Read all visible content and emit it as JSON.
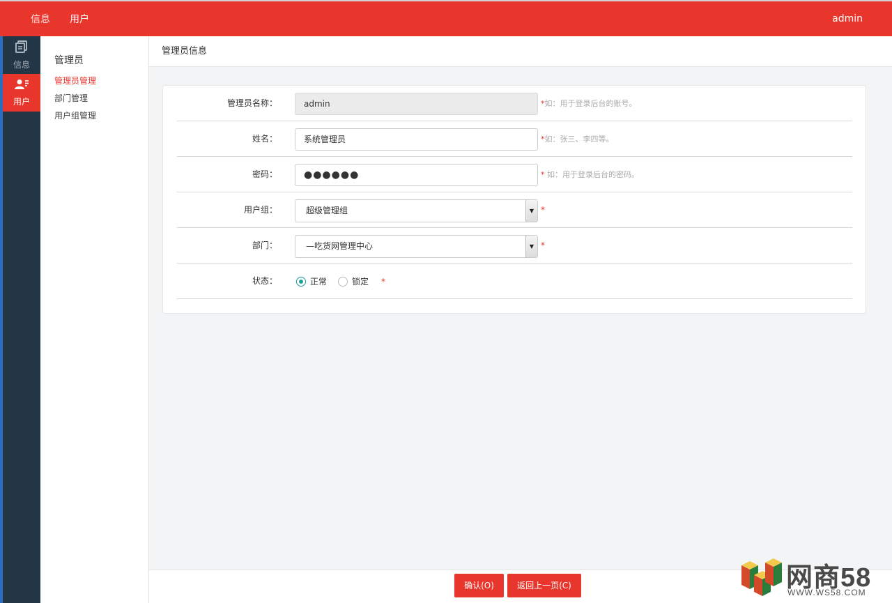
{
  "topnav": {
    "items": [
      "信息",
      "用户"
    ],
    "active_index": 1,
    "user": "admin"
  },
  "iconbar": {
    "tabs": [
      {
        "label": "信息",
        "icon": "document-stack-icon"
      },
      {
        "label": "用户",
        "icon": "user-list-icon"
      }
    ],
    "active_index": 1
  },
  "submenu": {
    "group_title": "管理员",
    "items": [
      "管理员管理",
      "部门管理",
      "用户组管理"
    ],
    "active_index": 0
  },
  "page": {
    "title": "管理员信息"
  },
  "form": {
    "username": {
      "label": "管理员名称：",
      "value": "admin",
      "hint_star": "*",
      "hint": "如：用于登录后台的账号。"
    },
    "realname": {
      "label": "姓名：",
      "value": "系统管理员",
      "hint_star": "*",
      "hint": "如：张三、李四等。"
    },
    "password": {
      "label": "密码：",
      "value": "●●●●●●",
      "hint_star": "*",
      "hint": " 如：用于登录后台的密码。"
    },
    "group": {
      "label": "用户组：",
      "selected": "超级管理组",
      "required": "*"
    },
    "department": {
      "label": "部门：",
      "selected": "—吃货网管理中心",
      "required": "*"
    },
    "status": {
      "label": "状态：",
      "options": [
        "正常",
        "锁定"
      ],
      "selected_index": 0,
      "required": "*"
    }
  },
  "buttons": {
    "confirm": "确认(O)",
    "back": "返回上一页(C)"
  },
  "watermark": {
    "brand": "网商58",
    "url": "WWW.WS58.COM"
  },
  "colors": {
    "accent": "#e8362c",
    "sidebar": "#233645",
    "radio_checked": "#1aa094"
  }
}
